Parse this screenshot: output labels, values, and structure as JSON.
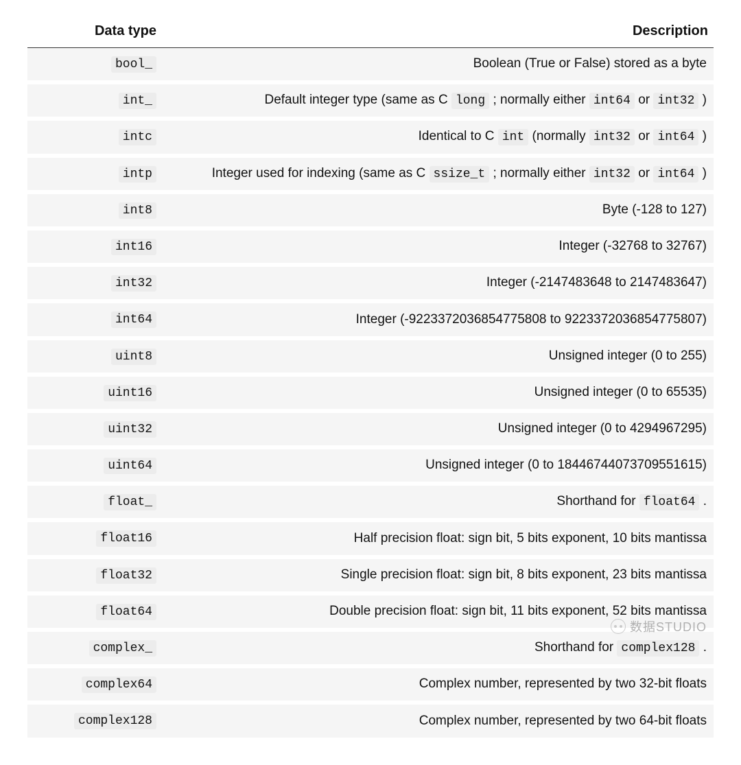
{
  "table": {
    "headers": {
      "type": "Data type",
      "desc": "Description"
    },
    "rows": [
      {
        "type_code": "bool_",
        "desc": [
          {
            "t": "text",
            "v": "Boolean (True or False) stored as a byte"
          }
        ]
      },
      {
        "type_code": "int_",
        "desc": [
          {
            "t": "text",
            "v": "Default integer type (same as C "
          },
          {
            "t": "code",
            "v": "long"
          },
          {
            "t": "text",
            "v": " ; normally either "
          },
          {
            "t": "code",
            "v": "int64"
          },
          {
            "t": "text",
            "v": " or "
          },
          {
            "t": "code",
            "v": "int32"
          },
          {
            "t": "text",
            "v": " )"
          }
        ]
      },
      {
        "type_code": "intc",
        "desc": [
          {
            "t": "text",
            "v": "Identical to C "
          },
          {
            "t": "code",
            "v": "int"
          },
          {
            "t": "text",
            "v": " (normally "
          },
          {
            "t": "code",
            "v": "int32"
          },
          {
            "t": "text",
            "v": " or "
          },
          {
            "t": "code",
            "v": "int64"
          },
          {
            "t": "text",
            "v": " )"
          }
        ]
      },
      {
        "type_code": "intp",
        "desc": [
          {
            "t": "text",
            "v": "Integer used for indexing (same as C "
          },
          {
            "t": "code",
            "v": "ssize_t"
          },
          {
            "t": "text",
            "v": " ; normally either "
          },
          {
            "t": "code",
            "v": "int32"
          },
          {
            "t": "text",
            "v": " or "
          },
          {
            "t": "code",
            "v": "int64"
          },
          {
            "t": "text",
            "v": " )"
          }
        ]
      },
      {
        "type_code": "int8",
        "desc": [
          {
            "t": "text",
            "v": "Byte (-128 to 127)"
          }
        ]
      },
      {
        "type_code": "int16",
        "desc": [
          {
            "t": "text",
            "v": "Integer (-32768 to 32767)"
          }
        ]
      },
      {
        "type_code": "int32",
        "desc": [
          {
            "t": "text",
            "v": "Integer (-2147483648 to 2147483647)"
          }
        ]
      },
      {
        "type_code": "int64",
        "desc": [
          {
            "t": "text",
            "v": "Integer (-9223372036854775808 to 9223372036854775807)"
          }
        ]
      },
      {
        "type_code": "uint8",
        "desc": [
          {
            "t": "text",
            "v": "Unsigned integer (0 to 255)"
          }
        ]
      },
      {
        "type_code": "uint16",
        "desc": [
          {
            "t": "text",
            "v": "Unsigned integer (0 to 65535)"
          }
        ]
      },
      {
        "type_code": "uint32",
        "desc": [
          {
            "t": "text",
            "v": "Unsigned integer (0 to 4294967295)"
          }
        ]
      },
      {
        "type_code": "uint64",
        "desc": [
          {
            "t": "text",
            "v": "Unsigned integer (0 to 18446744073709551615)"
          }
        ]
      },
      {
        "type_code": "float_",
        "desc": [
          {
            "t": "text",
            "v": "Shorthand for "
          },
          {
            "t": "code",
            "v": "float64"
          },
          {
            "t": "text",
            "v": " ."
          }
        ]
      },
      {
        "type_code": "float16",
        "desc": [
          {
            "t": "text",
            "v": "Half precision float: sign bit, 5 bits exponent, 10 bits mantissa"
          }
        ]
      },
      {
        "type_code": "float32",
        "desc": [
          {
            "t": "text",
            "v": "Single precision float: sign bit, 8 bits exponent, 23 bits mantissa"
          }
        ]
      },
      {
        "type_code": "float64",
        "desc": [
          {
            "t": "text",
            "v": "Double precision float: sign bit, 11 bits exponent, 52 bits mantissa"
          }
        ]
      },
      {
        "type_code": "complex_",
        "desc": [
          {
            "t": "text",
            "v": "Shorthand for "
          },
          {
            "t": "code",
            "v": "complex128"
          },
          {
            "t": "text",
            "v": " ."
          }
        ]
      },
      {
        "type_code": "complex64",
        "desc": [
          {
            "t": "text",
            "v": "Complex number, represented by two 32-bit floats"
          }
        ]
      },
      {
        "type_code": "complex128",
        "desc": [
          {
            "t": "text",
            "v": "Complex number, represented by two 64-bit floats"
          }
        ]
      }
    ]
  },
  "watermark": "数据STUDIO"
}
